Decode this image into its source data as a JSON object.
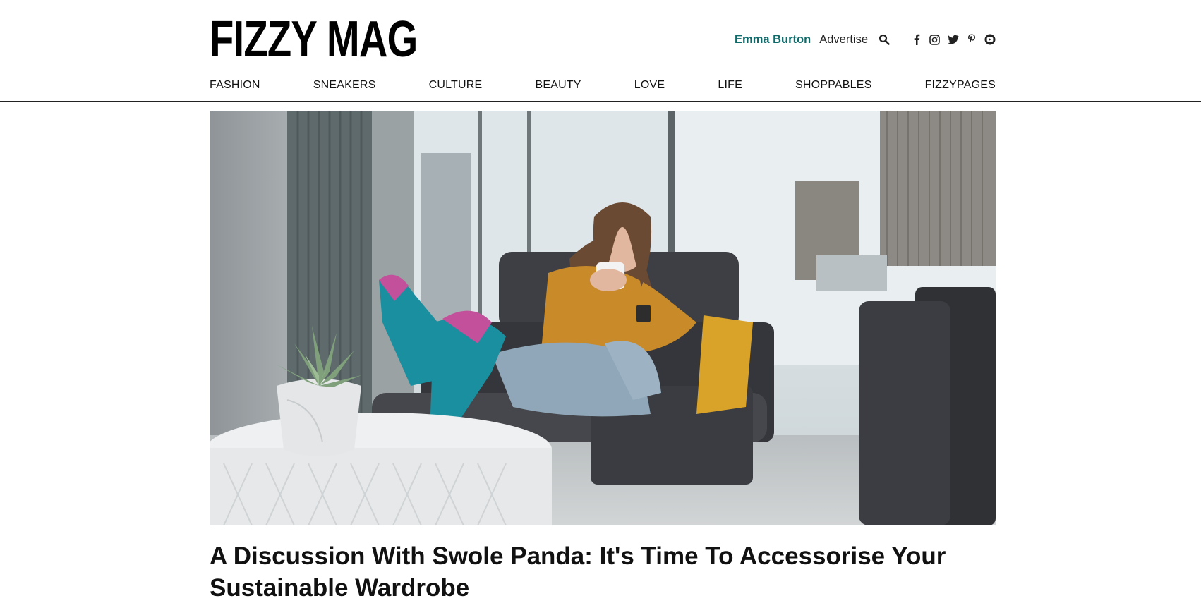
{
  "brand": {
    "logo_text": "FIZZY MAG"
  },
  "header": {
    "user_name": "Emma Burton",
    "advertise_label": "Advertise",
    "icons": [
      "search-icon",
      "facebook-icon",
      "instagram-icon",
      "twitter-icon",
      "pinterest-icon",
      "youtube-icon"
    ]
  },
  "nav": {
    "items": [
      {
        "label": "FASHION"
      },
      {
        "label": "SNEAKERS"
      },
      {
        "label": "CULTURE"
      },
      {
        "label": "BEAUTY"
      },
      {
        "label": "LOVE"
      },
      {
        "label": "LIFE"
      },
      {
        "label": "SHOPPABLES"
      },
      {
        "label": "FIZZYPAGES"
      }
    ]
  },
  "article": {
    "title": "A Discussion With Swole Panda: It's Time To Accessorise Your Sustainable Wardrobe"
  },
  "colors": {
    "accent": "#0e6b6b",
    "text": "#111111",
    "sock_teal": "#1a8fa0",
    "sock_pink": "#c2509a",
    "sweater": "#c98a2a"
  }
}
